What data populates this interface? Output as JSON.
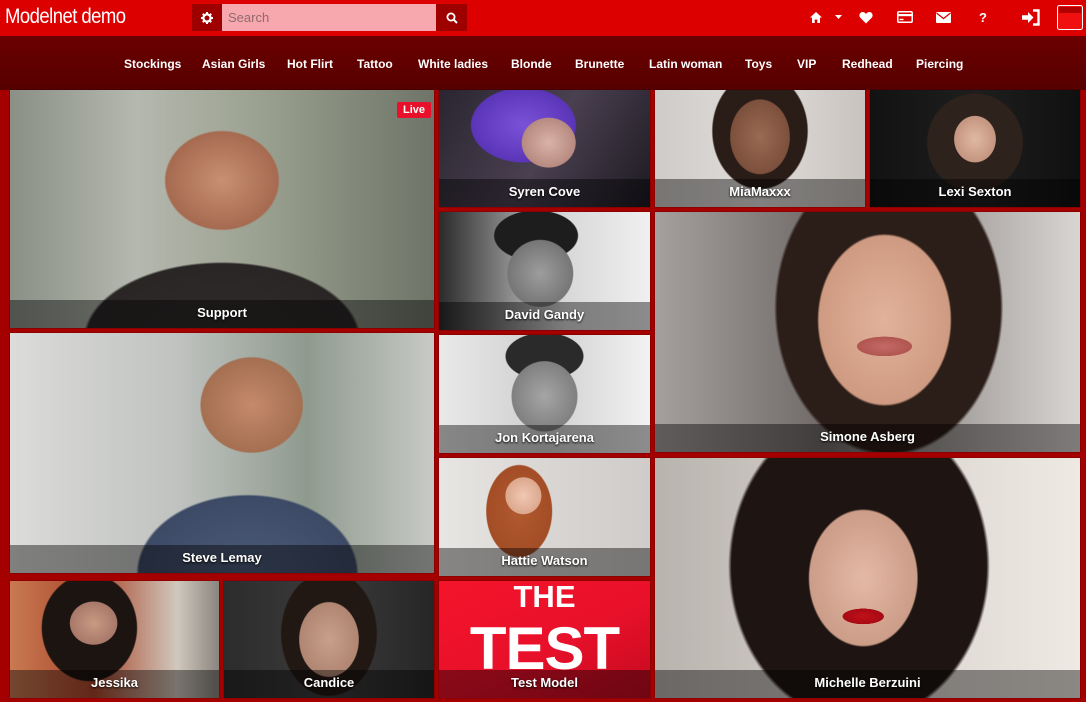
{
  "header": {
    "brand": "Modelnet demo",
    "search": {
      "placeholder": "Search",
      "value": ""
    },
    "icons": [
      "gear-icon",
      "search-icon",
      "home-icon",
      "caret-down-icon",
      "heart-icon",
      "credit-card-icon",
      "envelope-icon",
      "help-icon",
      "sign-in-icon",
      "flag-icon"
    ],
    "help_label": "?"
  },
  "categories": [
    "Stockings",
    "Asian Girls",
    "Hot Flirt",
    "Tattoo",
    "White ladies",
    "Blonde",
    "Brunette",
    "Latin woman",
    "Toys",
    "VIP",
    "Redhead",
    "Piercing"
  ],
  "models": [
    {
      "name": "Support",
      "badge": "Live"
    },
    {
      "name": "Syren Cove"
    },
    {
      "name": "MiaMaxxx"
    },
    {
      "name": "Lexi Sexton"
    },
    {
      "name": "David Gandy"
    },
    {
      "name": "Simone Asberg"
    },
    {
      "name": "Steve Lemay"
    },
    {
      "name": "Jon Kortajarena"
    },
    {
      "name": "Hattie Watson"
    },
    {
      "name": "Michelle Berzuini"
    },
    {
      "name": "Jessika"
    },
    {
      "name": "Candice"
    },
    {
      "name": "Test Model",
      "poster_line1": "THE",
      "poster_line2": "TEST"
    }
  ],
  "colors": {
    "topbar": "#dd0000",
    "nav": "#5c0000",
    "page": "#a50000",
    "live": "#e8102a"
  }
}
